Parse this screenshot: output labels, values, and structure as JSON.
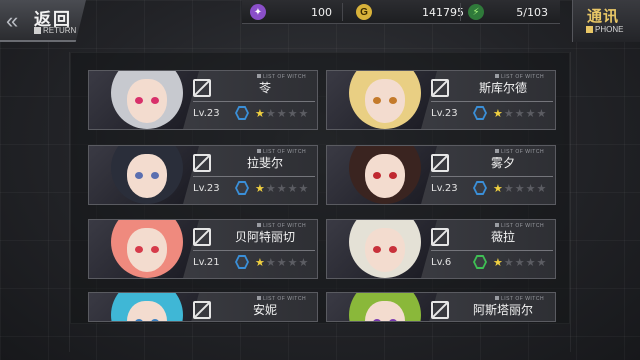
{
  "header": {
    "back_label": "返回",
    "back_sub": "RETURN",
    "phone_label": "通讯",
    "phone_sub": "PHONE"
  },
  "resources": [
    {
      "icon": "crystal-icon",
      "value": "100",
      "color": "#8a4fc9"
    },
    {
      "icon": "coin-icon",
      "value": "141795",
      "color": "#d8b23a"
    },
    {
      "icon": "stamina-icon",
      "value": "5/103",
      "color": "#2f7a3a"
    }
  ],
  "list_tag": "LIST OF WITCH",
  "witches": [
    {
      "name": "苓",
      "level": "Lv.23",
      "stars_on": 1,
      "stars_total": 5,
      "hex_color": "#3a8fd8",
      "hair": "#c7c9cf",
      "eye": "#d8306a"
    },
    {
      "name": "斯库尔德",
      "level": "Lv.23",
      "stars_on": 1,
      "stars_total": 5,
      "hex_color": "#3a8fd8",
      "hair": "#e9cf83",
      "eye": "#c47a2a"
    },
    {
      "name": "拉斐尔",
      "level": "Lv.23",
      "stars_on": 1,
      "stars_total": 5,
      "hex_color": "#3a8fd8",
      "hair": "#2a2e3a",
      "eye": "#5a6fb0"
    },
    {
      "name": "雾夕",
      "level": "Lv.23",
      "stars_on": 1,
      "stars_total": 5,
      "hex_color": "#3a8fd8",
      "hair": "#3a2420",
      "eye": "#c02830"
    },
    {
      "name": "贝阿特丽切",
      "level": "Lv.21",
      "stars_on": 1,
      "stars_total": 5,
      "hex_color": "#3a8fd8",
      "hair": "#ef8a7e",
      "eye": "#d63a4a"
    },
    {
      "name": "薇拉",
      "level": "Lv.6",
      "stars_on": 1,
      "stars_total": 5,
      "hex_color": "#3fbf54",
      "hair": "#e4e1d6",
      "eye": "#c8303a"
    },
    {
      "name": "安妮",
      "level": "",
      "stars_on": 0,
      "stars_total": 0,
      "hex_color": "#3a8fd8",
      "hair": "#3fb7d6",
      "eye": "#3a7fc0"
    },
    {
      "name": "阿斯塔丽尔",
      "level": "",
      "stars_on": 0,
      "stars_total": 0,
      "hex_color": "#3a8fd8",
      "hair": "#8ab83a",
      "eye": "#7a3ab0"
    }
  ]
}
